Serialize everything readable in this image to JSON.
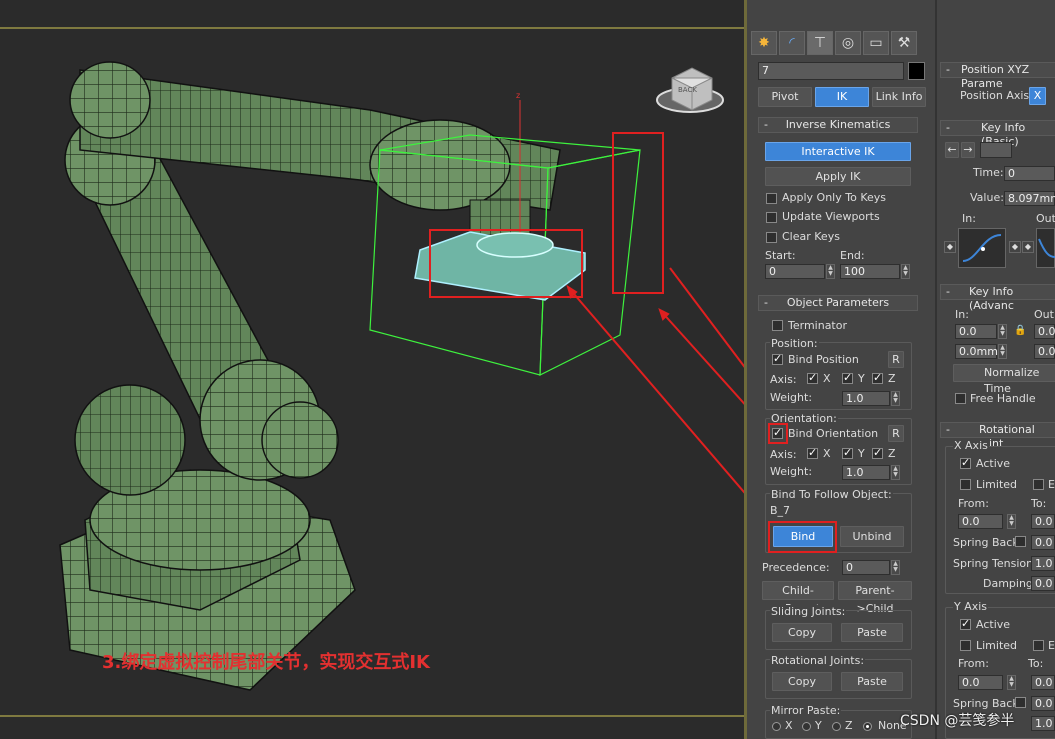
{
  "viewport": {
    "caption": "3.绑定虚拟控制尾部关节，实现交互式IK",
    "cube_label": "BACK"
  },
  "cmd_tabs": [
    "create-icon",
    "modify-icon",
    "hierarchy-icon",
    "motion-icon",
    "display-icon",
    "utilities-icon"
  ],
  "object_name": "7",
  "hier_tabs": {
    "pivot": "Pivot",
    "ik": "IK",
    "link_info": "Link Info"
  },
  "ik_rollout": {
    "title": "Inverse Kinematics",
    "interactive_ik": "Interactive IK",
    "apply_ik": "Apply IK",
    "apply_only_to_keys": "Apply Only To Keys",
    "update_viewports": "Update Viewports",
    "clear_keys": "Clear Keys",
    "start_label": "Start:",
    "end_label": "End:",
    "start_value": "0",
    "end_value": "100"
  },
  "obj_params": {
    "title": "Object Parameters",
    "terminator": "Terminator",
    "position_label": "Position:",
    "bind_position": "Bind Position",
    "r_button": "R",
    "axis_label": "Axis:",
    "x": "X",
    "y": "Y",
    "z": "Z",
    "weight_label": "Weight:",
    "pos_weight": "1.0",
    "orientation_label": "Orientation:",
    "bind_orientation": "Bind Orientation",
    "orient_weight": "1.0",
    "bind_follow_label": "Bind To Follow Object:",
    "follow_object": "B_7",
    "bind": "Bind",
    "unbind": "Unbind",
    "precedence_label": "Precedence:",
    "precedence_value": "0",
    "child_parent": "Child->Parent",
    "parent_child": "Parent->Child",
    "sliding_joints": "Sliding Joints:",
    "copy": "Copy",
    "paste": "Paste",
    "rotational_joints": "Rotational Joints:",
    "mirror_paste": "Mirror Paste:",
    "mirror_options": [
      "X",
      "Y",
      "Z",
      "None"
    ]
  },
  "right_panel": {
    "pos_xyz_title": "Position XYZ Parame",
    "position_axis_label": "Position Axis:",
    "position_axis_x": "X",
    "key_info_basic": "Key Info (Basic)",
    "time_label": "Time:",
    "time_value": "0",
    "value_label": "Value:",
    "value_value": "8.097mm",
    "in_label": "In:",
    "out_label": "Out",
    "key_info_adv": "Key Info (Advanc",
    "adv_in": "In:",
    "adv_out": "Out:",
    "adv_val1": "0.0",
    "adv_val2": "0.0mm",
    "adv_val3": "0.0",
    "adv_val4": "0.0",
    "normalize_time": "Normalize Time",
    "free_handle": "Free Handle",
    "rotational_joints_title": "Rotational Joint",
    "x_axis": "X Axis",
    "active": "Active",
    "limited": "Limited",
    "e_label": "E",
    "from_label": "From:",
    "to_label": "To:",
    "from_val": "0.0",
    "to_val": "0.0",
    "spring_back": "Spring Back",
    "spring_back_val": "0.0",
    "spring_tension": "Spring Tension:",
    "spring_tension_val": "1.0",
    "damping": "Damping:",
    "damping_val": "0.0",
    "y_axis": "Y Axis",
    "y_from_val": "0.0",
    "y_to_val": "0.0",
    "y_spring_val": "0.0",
    "y_tension_val": "1.0"
  },
  "watermark": "CSDN @芸笺参半"
}
